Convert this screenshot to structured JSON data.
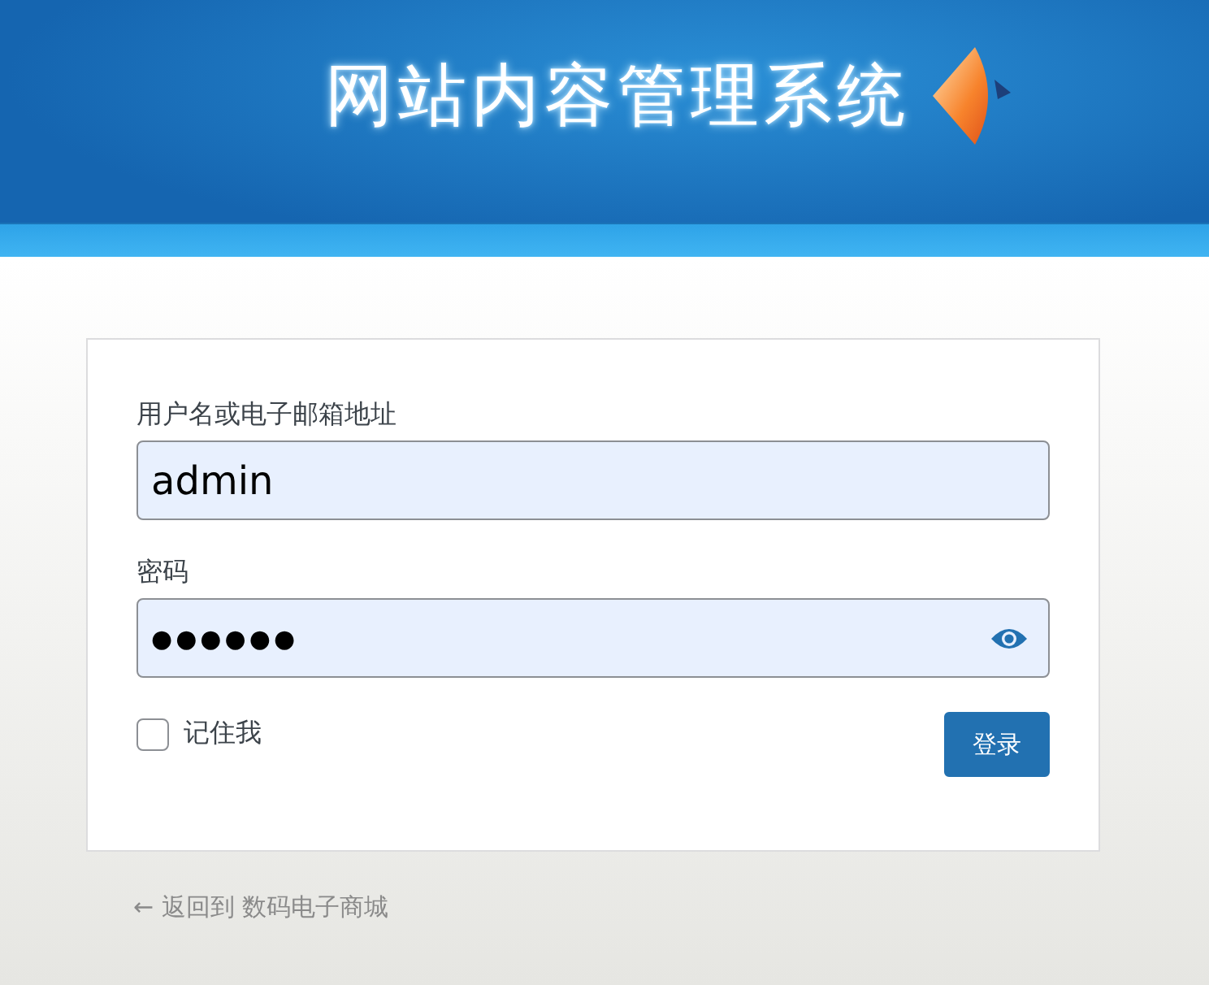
{
  "header": {
    "title": "网站内容管理系统"
  },
  "form": {
    "username": {
      "label": "用户名或电子邮箱地址",
      "value": "admin"
    },
    "password": {
      "label": "密码",
      "value": "●●●●●●"
    },
    "remember": {
      "label": "记住我",
      "checked": false
    },
    "submit": "登录"
  },
  "back_link": "← 返回到 数码电子商城"
}
